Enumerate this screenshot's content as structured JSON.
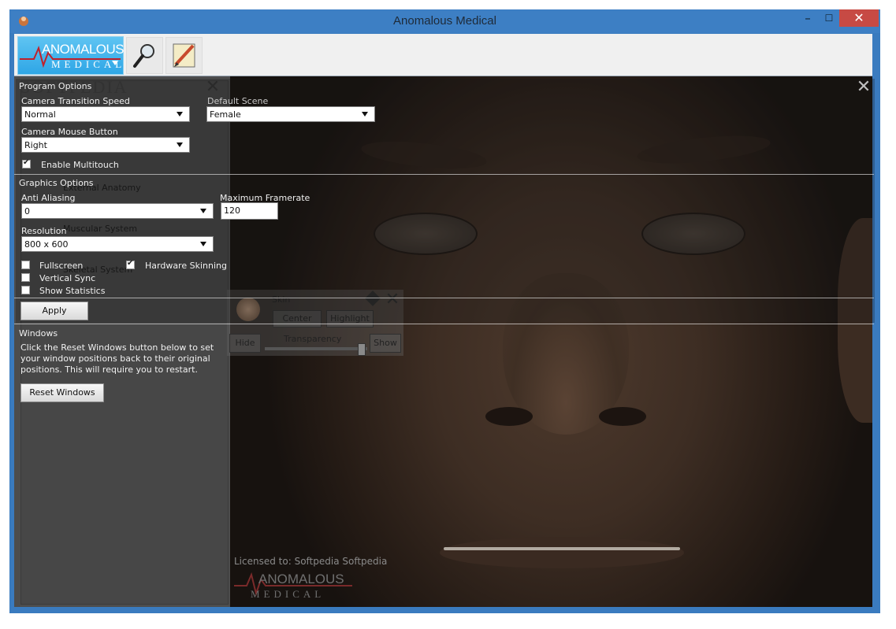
{
  "window": {
    "title": "Anomalous Medical",
    "minimize_glyph": "–",
    "maximize_glyph": "☐",
    "close_glyph": "✕"
  },
  "toolbar": {
    "logo_text_top": "ANOMALOUS",
    "logo_text_bottom": "MEDICAL",
    "search_icon": "magnifier-icon",
    "notes_icon": "pencil-paper-icon"
  },
  "program_options": {
    "section_title": "Program Options",
    "camera_transition_speed_label": "Camera Transition Speed",
    "camera_transition_speed_value": "Normal",
    "default_scene_label": "Default Scene",
    "default_scene_value": "Female",
    "camera_mouse_button_label": "Camera Mouse Button",
    "camera_mouse_button_value": "Right",
    "enable_multitouch_label": "Enable Multitouch",
    "enable_multitouch_checked": true
  },
  "graphics_options": {
    "section_title": "Graphics Options",
    "anti_aliasing_label": "Anti Aliasing",
    "anti_aliasing_value": "0",
    "max_framerate_label": "Maximum Framerate",
    "max_framerate_value": "120",
    "resolution_label": "Resolution",
    "resolution_value": "800 x 600",
    "fullscreen_label": "Fullscreen",
    "fullscreen_checked": false,
    "hardware_skinning_label": "Hardware Skinning",
    "hardware_skinning_checked": true,
    "vertical_sync_label": "Vertical Sync",
    "vertical_sync_checked": false,
    "show_statistics_label": "Show Statistics",
    "show_statistics_checked": false,
    "apply_label": "Apply"
  },
  "windows_section": {
    "section_title": "Windows",
    "description": "Click the Reset Windows button below to set your window positions back to their original positions. This will require you to restart.",
    "reset_label": "Reset Windows"
  },
  "background_panel": {
    "watermark": "SOFTPEDIA",
    "items": [
      "External Anatomy",
      "Muscular System",
      "Skeletal System"
    ]
  },
  "skin_panel": {
    "title": "Skin",
    "center_label": "Center",
    "highlight_label": "Highlight",
    "hide_label": "Hide",
    "transparency_label": "Transparency",
    "show_label": "Show"
  },
  "viewport": {
    "license_text": "Licensed to: Softpedia Softpedia",
    "watermark_top": "ANOMALOUS",
    "watermark_bottom": "MEDICAL"
  }
}
